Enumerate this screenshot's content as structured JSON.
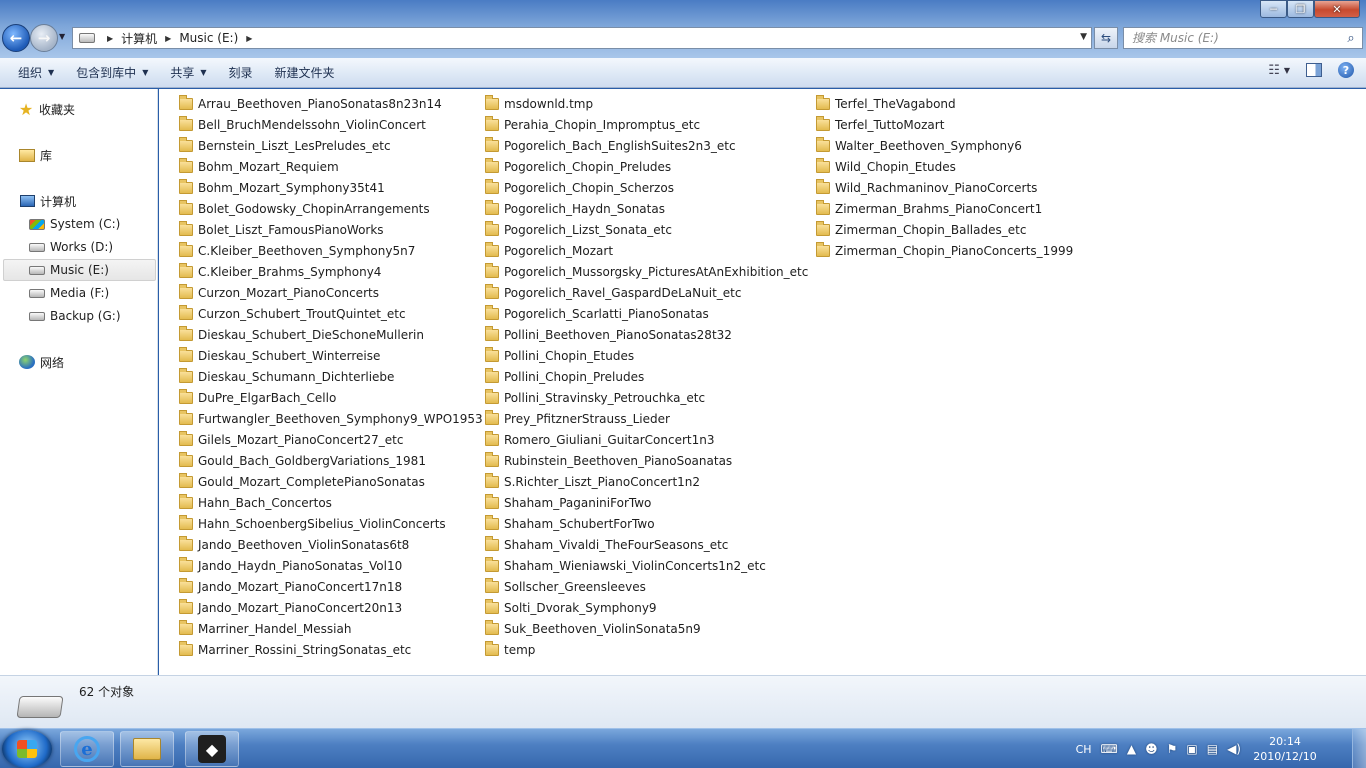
{
  "window_controls": {
    "minimize": "─",
    "maximize": "❐",
    "close": "✕"
  },
  "address": {
    "crumbs": [
      "计算机",
      "Music (E:)"
    ]
  },
  "search": {
    "placeholder": "搜索 Music (E:)"
  },
  "commandbar": {
    "organize": "组织",
    "include_in_library": "包含到库中",
    "share": "共享",
    "burn": "刻录",
    "new_folder": "新建文件夹"
  },
  "navigation": {
    "favorites": "收藏夹",
    "libraries": "库",
    "computer": "计算机",
    "drives": [
      "System (C:)",
      "Works (D:)",
      "Music (E:)",
      "Media (F:)",
      "Backup (G:)"
    ],
    "selected_drive": "Music (E:)",
    "network": "网络"
  },
  "files": {
    "column1": [
      "Arrau_Beethoven_PianoSonatas8n23n14",
      "Bell_BruchMendelssohn_ViolinConcert",
      "Bernstein_Liszt_LesPreludes_etc",
      "Bohm_Mozart_Requiem",
      "Bohm_Mozart_Symphony35t41",
      "Bolet_Godowsky_ChopinArrangements",
      "Bolet_Liszt_FamousPianoWorks",
      "C.Kleiber_Beethoven_Symphony5n7",
      "C.Kleiber_Brahms_Symphony4",
      "Curzon_Mozart_PianoConcerts",
      "Curzon_Schubert_TroutQuintet_etc",
      "Dieskau_Schubert_DieSchoneMullerin",
      "Dieskau_Schubert_Winterreise",
      "Dieskau_Schumann_Dichterliebe",
      "DuPre_ElgarBach_Cello",
      "Furtwangler_Beethoven_Symphony9_WPO1953",
      "Gilels_Mozart_PianoConcert27_etc",
      "Gould_Bach_GoldbergVariations_1981",
      "Gould_Mozart_CompletePianoSonatas",
      "Hahn_Bach_Concertos",
      "Hahn_SchoenbergSibelius_ViolinConcerts",
      "Jando_Beethoven_ViolinSonatas6t8",
      "Jando_Haydn_PianoSonatas_Vol10",
      "Jando_Mozart_PianoConcert17n18",
      "Jando_Mozart_PianoConcert20n13",
      "Marriner_Handel_Messiah",
      "Marriner_Rossini_StringSonatas_etc"
    ],
    "column2": [
      "msdownld.tmp",
      "Perahia_Chopin_Impromptus_etc",
      "Pogorelich_Bach_EnglishSuites2n3_etc",
      "Pogorelich_Chopin_Preludes",
      "Pogorelich_Chopin_Scherzos",
      "Pogorelich_Haydn_Sonatas",
      "Pogorelich_Lizst_Sonata_etc",
      "Pogorelich_Mozart",
      "Pogorelich_Mussorgsky_PicturesAtAnExhibition_etc",
      "Pogorelich_Ravel_GaspardDeLaNuit_etc",
      "Pogorelich_Scarlatti_PianoSonatas",
      "Pollini_Beethoven_PianoSonatas28t32",
      "Pollini_Chopin_Etudes",
      "Pollini_Chopin_Preludes",
      "Pollini_Stravinsky_Petrouchka_etc",
      "Prey_PfitznerStrauss_Lieder",
      "Romero_Giuliani_GuitarConcert1n3",
      "Rubinstein_Beethoven_PianoSoanatas",
      "S.Richter_Liszt_PianoConcert1n2",
      "Shaham_PaganiniForTwo",
      "Shaham_SchubertForTwo",
      "Shaham_Vivaldi_TheFourSeasons_etc",
      "Shaham_Wieniawski_ViolinConcerts1n2_etc",
      "Sollscher_Greensleeves",
      "Solti_Dvorak_Symphony9",
      "Suk_Beethoven_ViolinSonata5n9",
      "temp"
    ],
    "column3": [
      "Terfel_TheVagabond",
      "Terfel_TuttoMozart",
      "Walter_Beethoven_Symphony6",
      "Wild_Chopin_Etudes",
      "Wild_Rachmaninov_PianoCorcerts",
      "Zimerman_Brahms_PianoConcert1",
      "Zimerman_Chopin_Ballades_etc",
      "Zimerman_Chopin_PianoConcerts_1999"
    ]
  },
  "details": {
    "count": "62 个对象"
  },
  "taskbar": {
    "tray": {
      "language": "CH"
    },
    "clock": {
      "time": "20:14",
      "date": "2010/12/10"
    }
  },
  "colors": {
    "taskbar": "#3667ad",
    "folder": "#e3bb4f",
    "titlebar": "#4a7cc4"
  }
}
